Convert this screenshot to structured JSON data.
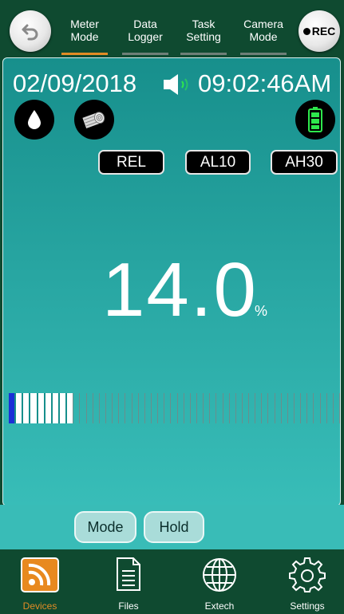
{
  "header": {
    "back_icon": "back-arrow-icon",
    "rec_label": "REC",
    "tabs": [
      {
        "line1": "Meter",
        "line2": "Mode",
        "active": true
      },
      {
        "line1": "Data",
        "line2": "Logger",
        "active": false
      },
      {
        "line1": "Task",
        "line2": "Setting",
        "active": false
      },
      {
        "line1": "Camera",
        "line2": "Mode",
        "active": false
      }
    ]
  },
  "display": {
    "date": "02/09/2018",
    "time": "09:02:46AM",
    "speaker_icon": "speaker-icon",
    "mode_icons": [
      "water-drop-icon",
      "wood-log-icon"
    ],
    "battery_icon": "battery-icon",
    "badges": {
      "rel": "REL",
      "al": "AL10",
      "ah": "AH30"
    },
    "reading": "14.0",
    "unit": "%",
    "bargraph": {
      "total_segments": 50,
      "lit_segments": 9,
      "marker_segments": 1
    }
  },
  "actions": {
    "mode": "Mode",
    "hold": "Hold"
  },
  "nav": {
    "devices": "Devices",
    "files": "Files",
    "extech": "Extech",
    "settings": "Settings"
  },
  "colors": {
    "accent": "#e28b25",
    "header_bg": "#0f4a30",
    "panel_top": "#178f8c",
    "panel_bottom": "#38bdb8",
    "bar_marker": "#1b2fd6"
  }
}
